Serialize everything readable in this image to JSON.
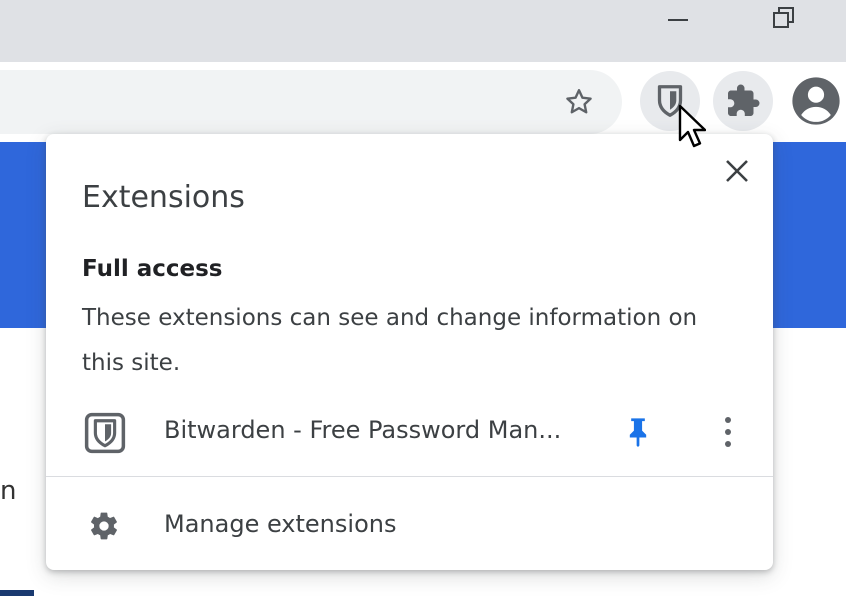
{
  "browser": {
    "window_controls": {
      "minimize_icon": "minimize-icon",
      "restore_icon": "restore-icon"
    },
    "toolbar": {
      "bookmark_icon": "star-icon",
      "bitwarden_icon": "bitwarden-shield-icon",
      "extensions_icon": "puzzle-piece-icon",
      "profile_icon": "account-circle-icon"
    },
    "page_edge_char": "n"
  },
  "extensions_popup": {
    "title": "Extensions",
    "close_icon": "close-icon",
    "full_access": {
      "heading": "Full access",
      "description": "These extensions can see and change information on this site."
    },
    "items": [
      {
        "name": "Bitwarden - Free Password Man...",
        "icon": "bitwarden-shield-icon",
        "pinned": true,
        "pin_color": "#1a73e8"
      }
    ],
    "manage": {
      "label": "Manage extensions",
      "icon": "gear-icon"
    }
  },
  "colors": {
    "page_accent": "#2f67db",
    "titlebar": "#dfe1e5",
    "omnibox": "#f1f3f4",
    "text": "#3c4043"
  }
}
